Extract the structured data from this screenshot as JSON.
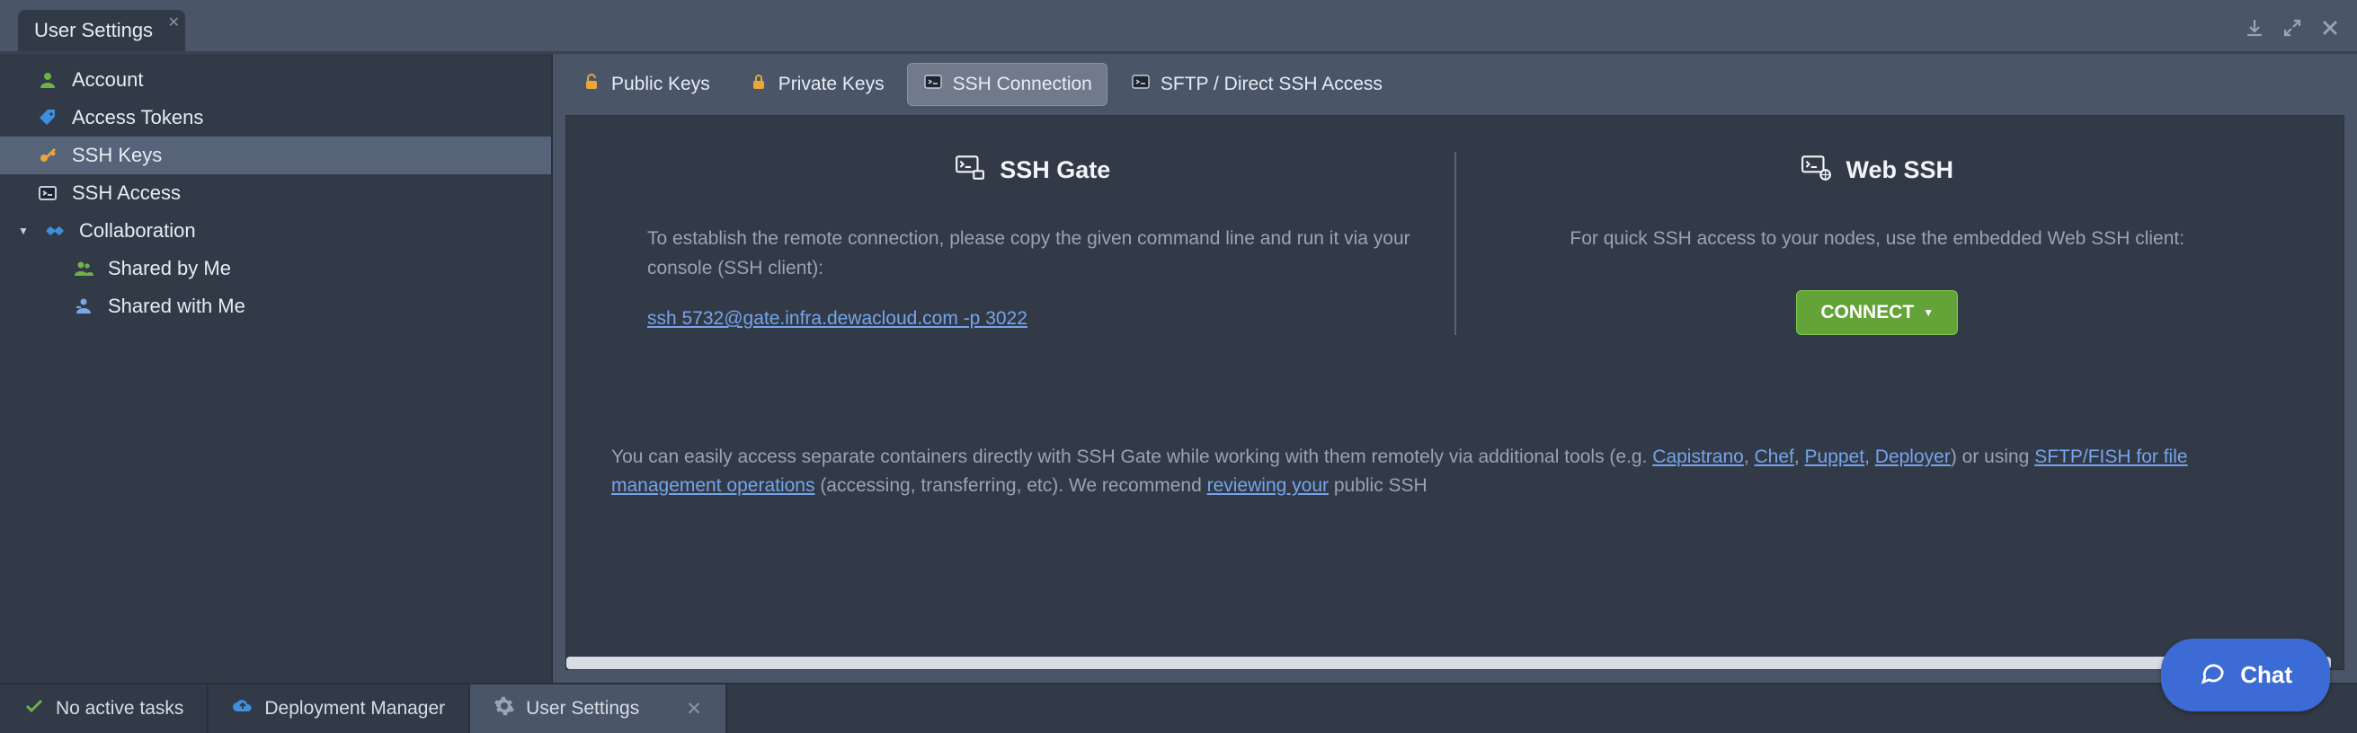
{
  "title_tab": {
    "label": "User Settings"
  },
  "sidebar": {
    "items": [
      {
        "label": "Account"
      },
      {
        "label": "Access Tokens"
      },
      {
        "label": "SSH Keys"
      },
      {
        "label": "SSH Access"
      },
      {
        "label": "Collaboration"
      },
      {
        "label": "Shared by Me"
      },
      {
        "label": "Shared with Me"
      }
    ]
  },
  "tabs": [
    {
      "label": "Public Keys"
    },
    {
      "label": "Private Keys"
    },
    {
      "label": "SSH Connection"
    },
    {
      "label": "SFTP / Direct SSH Access"
    }
  ],
  "ssh_gate": {
    "heading": "SSH Gate",
    "desc": "To establish the remote connection, please copy the given command line and run it via your console (SSH client):",
    "command": "ssh 5732@gate.infra.dewacloud.com -p 3022"
  },
  "web_ssh": {
    "heading": "Web SSH",
    "desc": "For quick SSH access to your nodes, use the embedded Web SSH client:",
    "button": "CONNECT"
  },
  "footer": {
    "t1": "You can easily access separate containers directly with SSH Gate while working with them remotely via additional tools (e.g. ",
    "l1": "Capistrano",
    "sep1": ", ",
    "l2": "Chef",
    "sep2": ", ",
    "l3": "Puppet",
    "sep3": ", ",
    "l4": "Deployer",
    "t2": ") or using ",
    "l5": "SFTP/FISH for file management operations",
    "t3": " (accessing, transferring, etc). We recommend ",
    "l6": "reviewing your",
    "t4": " public SSH"
  },
  "status": {
    "tasks": "No active tasks",
    "deployment": "Deployment Manager",
    "settings": "User Settings"
  },
  "chat": {
    "label": "Chat"
  }
}
